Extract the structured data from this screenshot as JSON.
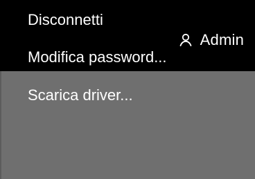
{
  "header": {
    "user_label": "Admin",
    "user_icon": "user-icon"
  },
  "user_menu": {
    "items": [
      {
        "label": "Disconnetti"
      },
      {
        "label": "Modifica password..."
      },
      {
        "label": "Scarica driver..."
      }
    ]
  },
  "colors": {
    "header_bg": "#000000",
    "menu_bg": "#6f6f6f",
    "text": "#ffffff"
  }
}
